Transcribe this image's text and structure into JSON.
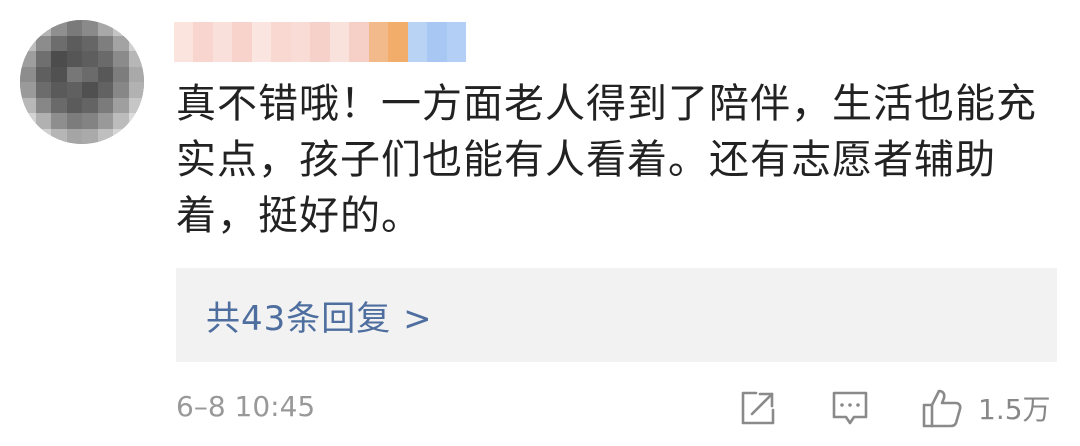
{
  "comment": {
    "username": "",
    "text": "真不错哦！一方面老人得到了陪伴，生活也能充实点，孩子们也能有人看着。还有志愿者辅助着，挺好的。",
    "replies_label": "共43条回复 >",
    "timestamp": "6–8 10:45",
    "like_count": "1.5万"
  },
  "icons": {
    "share": "share-icon",
    "reply": "comment-icon",
    "like": "thumbs-up-icon"
  },
  "colors": {
    "link": "#4d6e9e",
    "text": "#222222",
    "meta": "#999999",
    "reply_box_bg": "#f2f2f2"
  }
}
